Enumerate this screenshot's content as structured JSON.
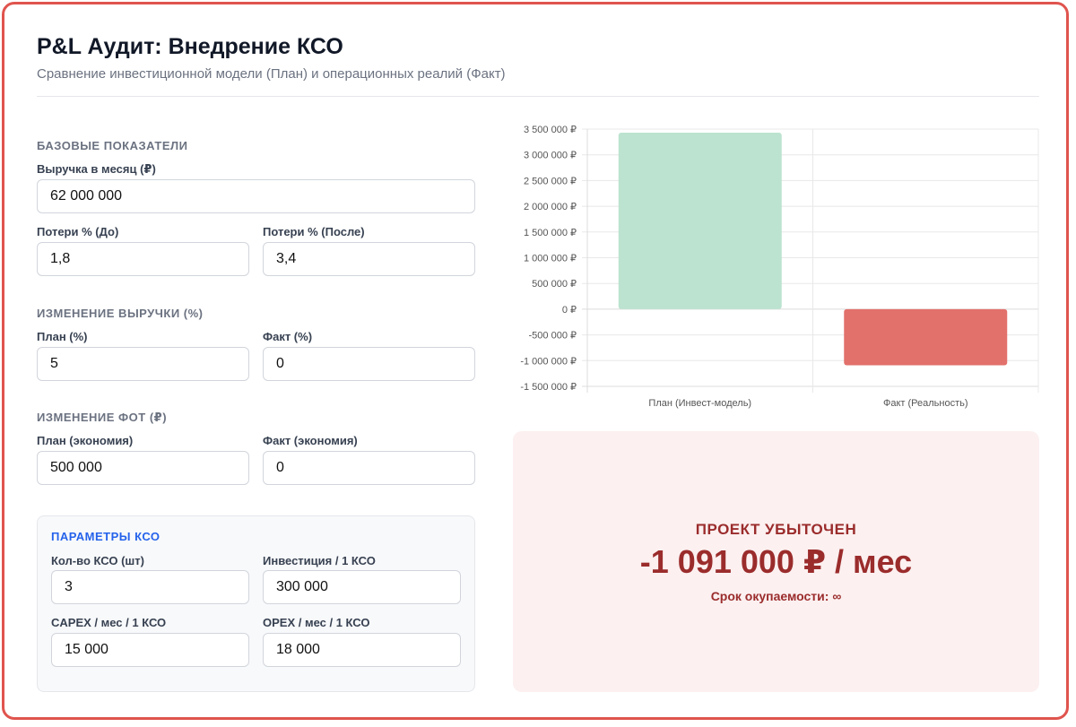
{
  "header": {
    "title": "P&L Аудит: Внедрение КСО",
    "subtitle": "Сравнение инвестиционной модели (План) и операционных реалий (Факт)"
  },
  "base": {
    "heading": "БАЗОВЫЕ ПОКАЗАТЕЛИ",
    "revenue_label": "Выручка в месяц (₽)",
    "revenue_value": "62 000 000",
    "loss_before_label": "Потери % (До)",
    "loss_before_value": "1,8",
    "loss_after_label": "Потери % (После)",
    "loss_after_value": "3,4"
  },
  "revenue_change": {
    "heading": "ИЗМЕНЕНИЕ ВЫРУЧКИ (%)",
    "plan_label": "План (%)",
    "plan_value": "5",
    "fact_label": "Факт (%)",
    "fact_value": "0"
  },
  "payroll_change": {
    "heading": "ИЗМЕНЕНИЕ ФОТ (₽)",
    "plan_label": "План (экономия)",
    "plan_value": "500 000",
    "fact_label": "Факт (экономия)",
    "fact_value": "0"
  },
  "kso": {
    "heading": "ПАРАМЕТРЫ КСО",
    "count_label": "Кол-во КСО (шт)",
    "count_value": "3",
    "invest_label": "Инвестиция / 1 КСО",
    "invest_value": "300 000",
    "capex_label": "CAPEX / мес / 1 КСО",
    "capex_value": "15 000",
    "opex_label": "OPEX / мес / 1 КСО",
    "opex_value": "18 000"
  },
  "result": {
    "status": "ПРОЕКТ УБЫТОЧЕН",
    "value": "-1 091 000 ₽ / мес",
    "payback": "Срок окупаемости: ∞"
  },
  "colors": {
    "accent": "#2563eb",
    "positive": "#bce3cf",
    "negative": "#e2706b",
    "loss_text": "#9b2c2c"
  },
  "chart_data": {
    "type": "bar",
    "categories": [
      "План (Инвест-модель)",
      "Факт (Реальность)"
    ],
    "values": [
      3430000,
      -1091000
    ],
    "ylim": [
      -1500000,
      3500000
    ],
    "yticks": [
      3500000,
      3000000,
      2500000,
      2000000,
      1500000,
      1000000,
      500000,
      0,
      -500000,
      -1000000,
      -1500000
    ],
    "ytick_labels": [
      "3 500 000 ₽",
      "3 000 000 ₽",
      "2 500 000 ₽",
      "2 000 000 ₽",
      "1 500 000 ₽",
      "1 000 000 ₽",
      "500 000 ₽",
      "0 ₽",
      "-500 000 ₽",
      "-1 000 000 ₽",
      "-1 500 000 ₽"
    ],
    "grid": true,
    "legend": "none",
    "title": "",
    "xlabel": "",
    "ylabel": ""
  }
}
